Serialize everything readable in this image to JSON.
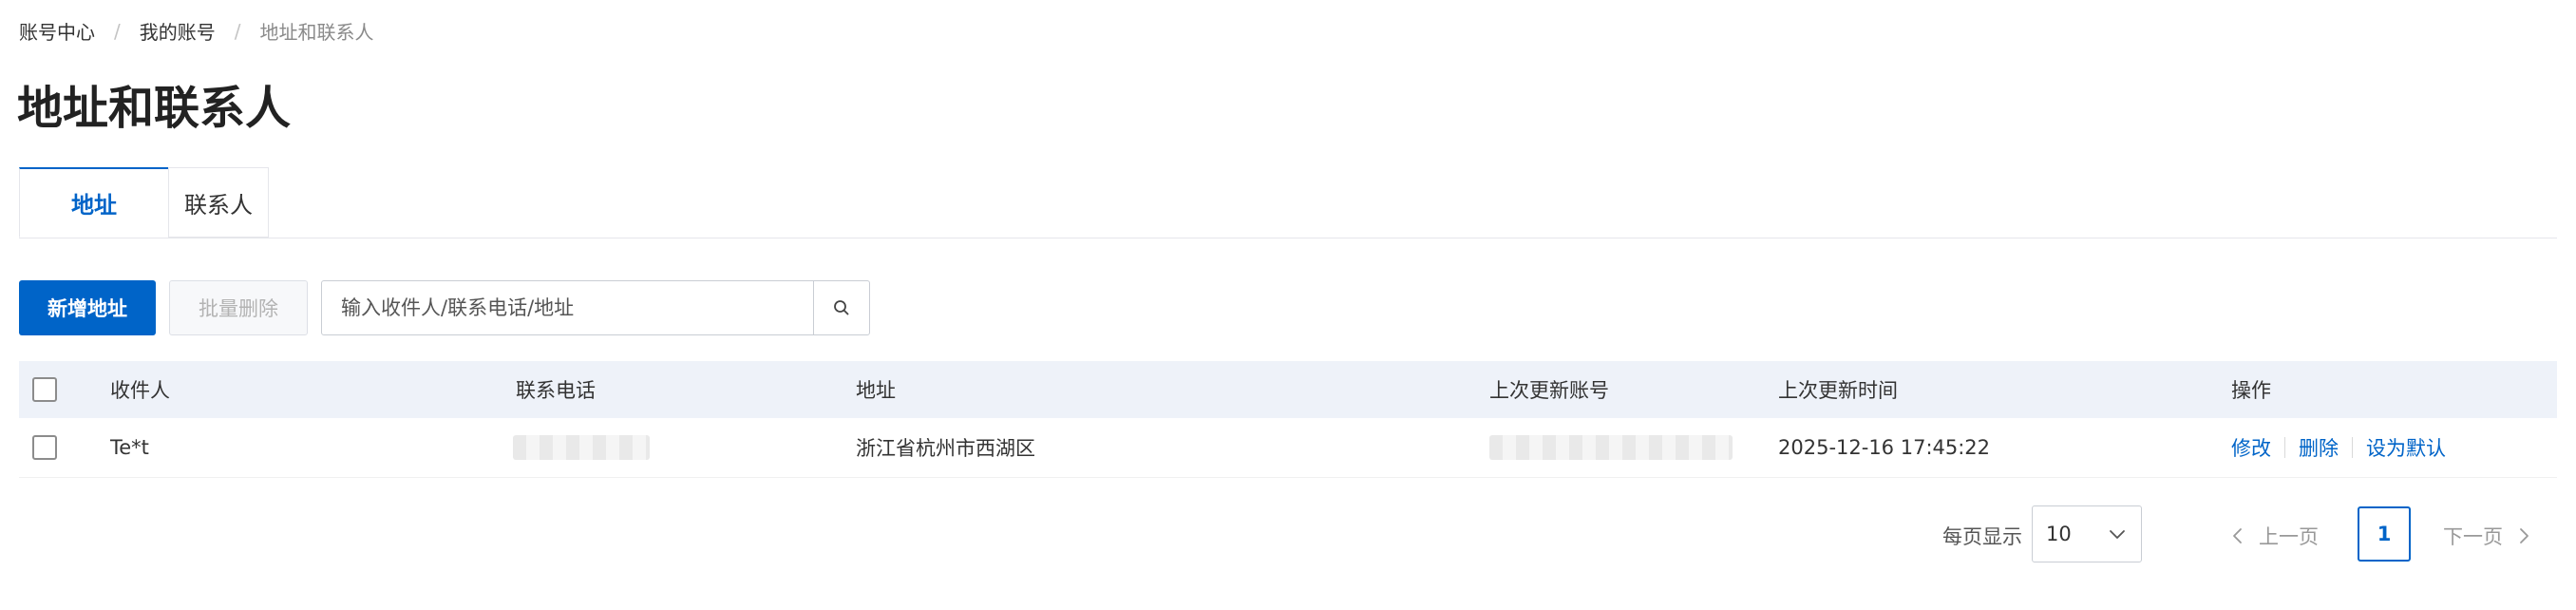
{
  "breadcrumb": {
    "items": [
      "账号中心",
      "我的账号",
      "地址和联系人"
    ],
    "separator": "/"
  },
  "page_title": "地址和联系人",
  "tabs": [
    {
      "label": "地址",
      "active": true
    },
    {
      "label": "联系人",
      "active": false
    }
  ],
  "toolbar": {
    "add_label": "新增地址",
    "batch_delete_label": "批量删除",
    "search_placeholder": "输入收件人/联系电话/地址",
    "search_icon": "search-icon"
  },
  "table": {
    "columns": [
      "收件人",
      "联系电话",
      "地址",
      "上次更新账号",
      "上次更新时间",
      "操作"
    ],
    "rows": [
      {
        "recipient": "Te*t",
        "phone": "",
        "address": "浙江省杭州市西湖区",
        "updated_by": "",
        "updated_at": "2025-12-16 17:45:22",
        "actions": [
          "修改",
          "删除",
          "设为默认"
        ]
      }
    ]
  },
  "pagination": {
    "page_size_label": "每页显示",
    "page_size": "10",
    "prev_label": "上一页",
    "next_label": "下一页",
    "current_page": "1"
  },
  "colors": {
    "primary": "#0064c8",
    "header_bg": "#eef2f9"
  }
}
